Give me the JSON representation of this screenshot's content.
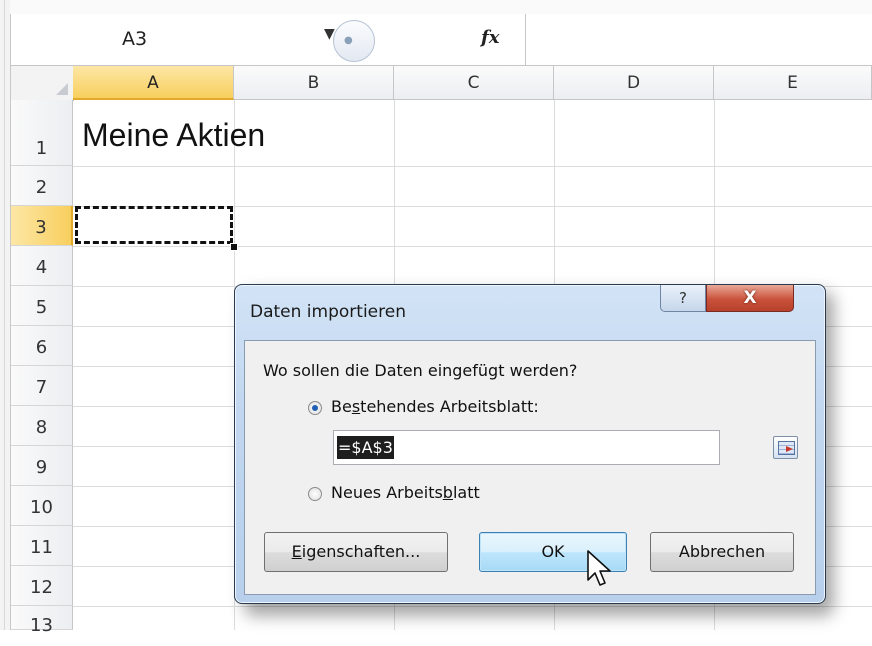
{
  "formula_bar": {
    "name_box": "A3",
    "fx_label": "fx",
    "formula": ""
  },
  "grid": {
    "columns": [
      "A",
      "B",
      "C",
      "D",
      "E"
    ],
    "rows": [
      "1",
      "2",
      "3",
      "4",
      "5",
      "6",
      "7",
      "8",
      "9",
      "10",
      "11",
      "12",
      "13"
    ],
    "selected_column": "A",
    "selected_row": "3",
    "cells": {
      "A1": "Meine Aktien"
    }
  },
  "dialog": {
    "title": "Daten importieren",
    "help_label": "?",
    "close_label": "X",
    "question": "Wo sollen die Daten eingefügt werden?",
    "options": [
      {
        "pre": "Be",
        "accel": "s",
        "post": "tehendes Arbeitsblatt:",
        "selected": true
      },
      {
        "pre": "Neues Arbeits",
        "accel": "b",
        "post": "latt",
        "selected": false
      }
    ],
    "reference_value": "=$A$3",
    "buttons": {
      "properties": {
        "pre": "",
        "accel": "E",
        "post": "igenschaften..."
      },
      "ok": "OK",
      "cancel": "Abbrechen"
    }
  },
  "colors": {
    "selected_header": "#f8cf5e",
    "dialog_frame": "#c1d7ef",
    "close_button": "#c9523c",
    "radio_dot": "#1f5fb4"
  },
  "icons": [
    "dropdown-arrow-icon",
    "fx-icon",
    "help-icon",
    "close-icon",
    "range-select-icon",
    "mouse-cursor-icon"
  ]
}
